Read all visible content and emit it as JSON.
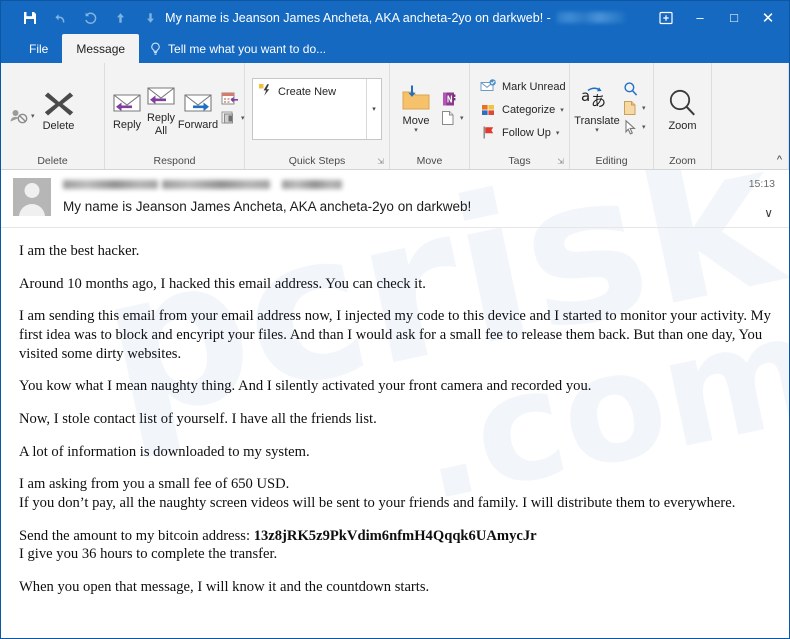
{
  "window": {
    "title": "My name is Jeanson James Ancheta, AKA ancheta-2yo on darkweb! -",
    "quick_access": [
      {
        "name": "save",
        "label": "Save"
      },
      {
        "name": "undo",
        "label": "Undo"
      },
      {
        "name": "redo",
        "label": "Redo"
      },
      {
        "name": "previous-item",
        "label": "Previous Item"
      },
      {
        "name": "next-item",
        "label": "Next Item"
      },
      {
        "name": "customize-quick-access-toolbar",
        "label": "▾"
      }
    ],
    "controls": {
      "ribbon_options": "Ribbon Display Options",
      "minimize": "–",
      "maximize": "□",
      "close": "✕"
    }
  },
  "tabs": {
    "file": "File",
    "message": "Message",
    "tellme": "Tell me what you want to do..."
  },
  "ribbon": {
    "collapse_label": "^",
    "groups": [
      {
        "name": "delete",
        "label": "Delete",
        "buttons": [
          {
            "name": "ignore",
            "label": ""
          },
          {
            "name": "delete",
            "label": "Delete"
          }
        ]
      },
      {
        "name": "respond",
        "label": "Respond",
        "buttons": [
          {
            "name": "reply",
            "label": "Reply"
          },
          {
            "name": "reply-all",
            "label": "Reply\nAll"
          },
          {
            "name": "forward",
            "label": "Forward"
          },
          {
            "name": "meeting",
            "label": ""
          },
          {
            "name": "more-respond",
            "label": ""
          }
        ]
      },
      {
        "name": "quick-steps",
        "label": "Quick Steps",
        "gallery_item": "Create New",
        "dialog_launcher": "⬌"
      },
      {
        "name": "move",
        "label": "Move",
        "buttons": [
          {
            "name": "move",
            "label": "Move"
          },
          {
            "name": "onenote",
            "label": ""
          },
          {
            "name": "rules",
            "label": ""
          }
        ]
      },
      {
        "name": "tags",
        "label": "Tags",
        "dialog_launcher": "⬌",
        "buttons": [
          {
            "name": "mark-unread",
            "label": "Mark Unread"
          },
          {
            "name": "categorize",
            "label": "Categorize"
          },
          {
            "name": "follow-up",
            "label": "Follow Up"
          }
        ]
      },
      {
        "name": "editing",
        "label": "Editing",
        "buttons": [
          {
            "name": "translate",
            "label": "Translate"
          },
          {
            "name": "find",
            "label": ""
          },
          {
            "name": "related",
            "label": ""
          },
          {
            "name": "select",
            "label": ""
          }
        ]
      },
      {
        "name": "zoom",
        "label": "Zoom",
        "buttons": [
          {
            "name": "zoom",
            "label": "Zoom"
          }
        ]
      }
    ]
  },
  "message": {
    "sender_redacted": true,
    "time": "15:13",
    "subject": "My name is Jeanson James Ancheta, AKA ancheta-2yo on darkweb!",
    "expand_icon": "∨",
    "body": [
      "I am the best hacker.",
      "Around 10 months ago, I hacked this email address. You can check it.",
      "I am sending this email from your email address now, I injected my code to this device and I started to monitor your activity. My first idea was to block and encyript your files. And than I would ask for a small fee to release them back. But than one day, You visited some dirty websites.",
      "You kow what I mean naughty thing. And I silently activated your front camera and recorded you.",
      "Now, I stole contact list of yourself. I have all the friends list.",
      "A lot of information is downloaded to my system."
    ],
    "fee_line_1": "I am asking from you a small fee of 650 USD.",
    "fee_line_2": "If you don’t pay, all the naughty screen videos will be sent to your friends and family. I will distribute them to everywhere.",
    "btc_prefix": "Send the amount to my bitcoin address: ",
    "btc_address": "13z8jRK5z9PkVdim6nfmH4Qqqk6UAmycJr",
    "btc_line_2": "I give you 36 hours to complete the transfer.",
    "closing": "When you open that message, I will know it and the countdown starts."
  },
  "colors": {
    "titlebar": "#1569c0",
    "ribbon_bg": "#f3f3f3",
    "accent_purple": "#7e3fa0",
    "accent_blue": "#1f6fc4",
    "folder_yellow": "#f5c26b",
    "flag_red": "#e03a30"
  }
}
